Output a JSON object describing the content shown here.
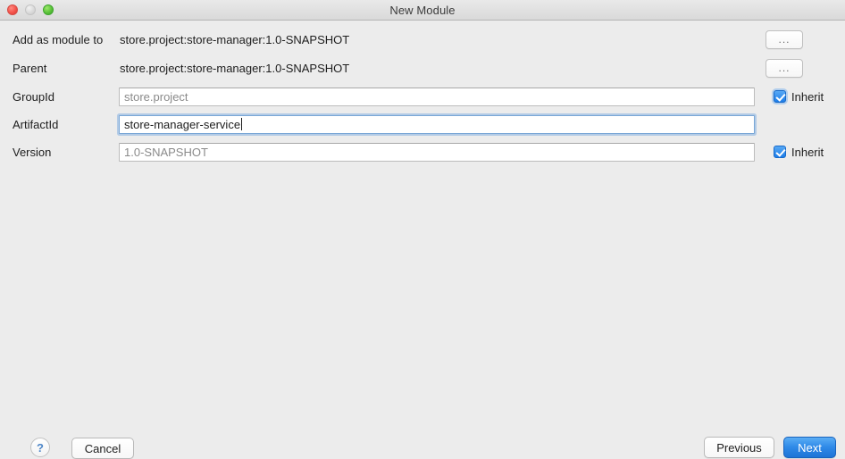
{
  "window": {
    "title": "New Module",
    "traffic_lights": [
      "close",
      "minimize",
      "zoom"
    ]
  },
  "form": {
    "rows": [
      {
        "label": "Add as module to",
        "value": "store.project:store-manager:1.0-SNAPSHOT",
        "browse_label": "..."
      },
      {
        "label": "Parent",
        "value": "store.project:store-manager:1.0-SNAPSHOT",
        "browse_label": "..."
      },
      {
        "label": "GroupId",
        "value": "store.project",
        "inherit_label": "Inherit",
        "inherit_checked": true
      },
      {
        "label": "ArtifactId",
        "value": "store-manager-service",
        "focused": true
      },
      {
        "label": "Version",
        "value": "1.0-SNAPSHOT",
        "inherit_label": "Inherit",
        "inherit_checked": true
      }
    ]
  },
  "footer": {
    "help_label": "?",
    "cancel_label": "Cancel",
    "previous_label": "Previous",
    "next_label": "Next"
  },
  "colors": {
    "accent": "#2f8ae8",
    "background": "#ececec",
    "focus_ring": "#7aa7d6",
    "disabled_text": "#8a8a8a"
  }
}
